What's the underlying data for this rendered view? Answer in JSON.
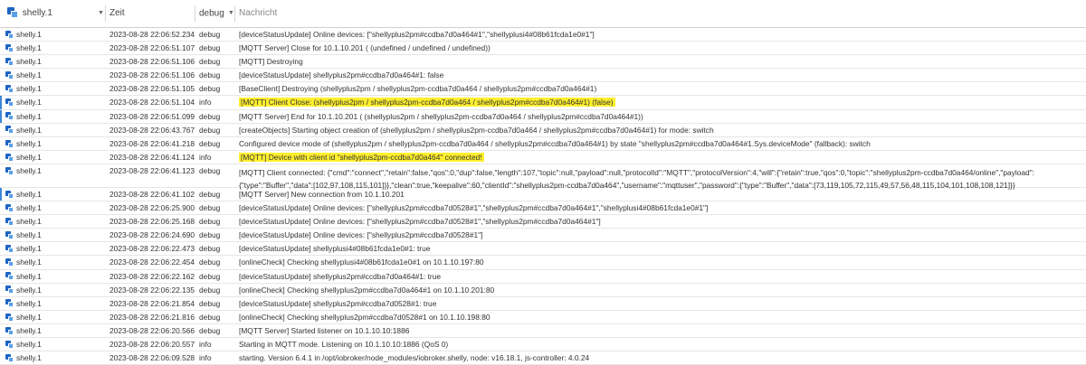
{
  "header": {
    "source_filter": "shelly.1",
    "col_time": "Zeit",
    "col_severity_filter": "debug",
    "col_message": "Nachricht"
  },
  "rows": [
    {
      "source": "shelly.1",
      "time": "2023-08-28 22:06:52.234",
      "severity": "debug",
      "message": "[deviceStatusUpdate] Online devices: [\"shellyplus2pm#ccdba7d0a464#1\",\"shellyplusi4#08b61fcda1e0#1\"]",
      "highlight": false,
      "marked": false
    },
    {
      "source": "shelly.1",
      "time": "2023-08-28 22:06:51.107",
      "severity": "debug",
      "message": "[MQTT Server] Close for 10.1.10.201 ( (undefined / undefined / undefined))",
      "highlight": false,
      "marked": false
    },
    {
      "source": "shelly.1",
      "time": "2023-08-28 22:06:51.106",
      "severity": "debug",
      "message": "[MQTT] Destroying",
      "highlight": false,
      "marked": false
    },
    {
      "source": "shelly.1",
      "time": "2023-08-28 22:06:51.106",
      "severity": "debug",
      "message": "[deviceStatusUpdate] shellyplus2pm#ccdba7d0a464#1: false",
      "highlight": false,
      "marked": false
    },
    {
      "source": "shelly.1",
      "time": "2023-08-28 22:06:51.105",
      "severity": "debug",
      "message": "[BaseClient] Destroying (shellyplus2pm / shellyplus2pm-ccdba7d0a464 / shellyplus2pm#ccdba7d0a464#1)",
      "highlight": false,
      "marked": false
    },
    {
      "source": "shelly.1",
      "time": "2023-08-28 22:06:51.104",
      "severity": "info",
      "message": "[MQTT] Client Close: (shellyplus2pm / shellyplus2pm-ccdba7d0a464 / shellyplus2pm#ccdba7d0a464#1) (false)",
      "highlight": true,
      "marked": true
    },
    {
      "source": "shelly.1",
      "time": "2023-08-28 22:06:51.099",
      "severity": "debug",
      "message": "[MQTT Server] End for 10.1.10.201 ( (shellyplus2pm / shellyplus2pm-ccdba7d0a464 / shellyplus2pm#ccdba7d0a464#1))",
      "highlight": false,
      "marked": true
    },
    {
      "source": "shelly.1",
      "time": "2023-08-28 22:06:43.767",
      "severity": "debug",
      "message": "[createObjects] Starting object creation of (shellyplus2pm / shellyplus2pm-ccdba7d0a464 / shellyplus2pm#ccdba7d0a464#1) for mode: switch",
      "highlight": false,
      "marked": false
    },
    {
      "source": "shelly.1",
      "time": "2023-08-28 22:06:41.218",
      "severity": "debug",
      "message": "Configured device mode of (shellyplus2pm / shellyplus2pm-ccdba7d0a464 / shellyplus2pm#ccdba7d0a464#1) by state \"shellyplus2pm#ccdba7d0a464#1.Sys.deviceMode\" (fallback): switch",
      "highlight": false,
      "marked": false
    },
    {
      "source": "shelly.1",
      "time": "2023-08-28 22:06:41.124",
      "severity": "info",
      "message": "[MQTT] Device with client id \"shellyplus2pm-ccdba7d0a464\" connected!",
      "highlight": true,
      "marked": false
    },
    {
      "source": "shelly.1",
      "time": "2023-08-28 22:06:41.123",
      "severity": "debug",
      "message": "[MQTT] Client connected: {\"cmd\":\"connect\",\"retain\":false,\"qos\":0,\"dup\":false,\"length\":107,\"topic\":null,\"payload\":null,\"protocolId\":\"MQTT\",\"protocolVersion\":4,\"will\":{\"retain\":true,\"qos\":0,\"topic\":\"shellyplus2pm-ccdba7d0a464/online\",\"payload\":{\"type\":\"Buffer\",\"data\":[102,97,108,115,101]}},\"clean\":true,\"keepalive\":60,\"clientId\":\"shellyplus2pm-ccdba7d0a464\",\"username\":\"mqttuser\",\"password\":{\"type\":\"Buffer\",\"data\":[73,119,105,72,115,49,57,56,48,115,104,101,108,108,121]}}",
      "highlight": false,
      "marked": false,
      "tall": true
    },
    {
      "source": "shelly.1",
      "time": "2023-08-28 22:06:41.102",
      "severity": "debug",
      "message": "[MQTT Server] New connection from 10.1.10.201",
      "highlight": false,
      "marked": true
    },
    {
      "source": "shelly.1",
      "time": "2023-08-28 22:06:25.900",
      "severity": "debug",
      "message": "[deviceStatusUpdate] Online devices: [\"shellyplus2pm#ccdba7d0528#1\",\"shellyplus2pm#ccdba7d0a464#1\",\"shellyplusi4#08b61fcda1e0#1\"]",
      "highlight": false,
      "marked": false
    },
    {
      "source": "shelly.1",
      "time": "2023-08-28 22:06:25.168",
      "severity": "debug",
      "message": "[deviceStatusUpdate] Online devices: [\"shellyplus2pm#ccdba7d0528#1\",\"shellyplus2pm#ccdba7d0a464#1\"]",
      "highlight": false,
      "marked": false
    },
    {
      "source": "shelly.1",
      "time": "2023-08-28 22:06:24.690",
      "severity": "debug",
      "message": "[deviceStatusUpdate] Online devices: [\"shellyplus2pm#ccdba7d0528#1\"]",
      "highlight": false,
      "marked": false
    },
    {
      "source": "shelly.1",
      "time": "2023-08-28 22:06:22.473",
      "severity": "debug",
      "message": "[deviceStatusUpdate] shellyplusi4#08b61fcda1e0#1: true",
      "highlight": false,
      "marked": false
    },
    {
      "source": "shelly.1",
      "time": "2023-08-28 22:06:22.454",
      "severity": "debug",
      "message": "[onlineCheck] Checking shellyplusi4#08b61fcda1e0#1 on 10.1.10.197:80",
      "highlight": false,
      "marked": false
    },
    {
      "source": "shelly.1",
      "time": "2023-08-28 22:06:22.162",
      "severity": "debug",
      "message": "[deviceStatusUpdate] shellyplus2pm#ccdba7d0a464#1: true",
      "highlight": false,
      "marked": false
    },
    {
      "source": "shelly.1",
      "time": "2023-08-28 22:06:22.135",
      "severity": "debug",
      "message": "[onlineCheck] Checking shellyplus2pm#ccdba7d0a464#1 on 10.1.10.201:80",
      "highlight": false,
      "marked": false
    },
    {
      "source": "shelly.1",
      "time": "2023-08-28 22:06:21.854",
      "severity": "debug",
      "message": "[deviceStatusUpdate] shellyplus2pm#ccdba7d0528#1: true",
      "highlight": false,
      "marked": false
    },
    {
      "source": "shelly.1",
      "time": "2023-08-28 22:06:21.816",
      "severity": "debug",
      "message": "[onlineCheck] Checking shellyplus2pm#ccdba7d0528#1 on 10.1.10.198:80",
      "highlight": false,
      "marked": false
    },
    {
      "source": "shelly.1",
      "time": "2023-08-28 22:06:20.566",
      "severity": "debug",
      "message": "[MQTT Server] Started listener on 10.1.10.10:1886",
      "highlight": false,
      "marked": false
    },
    {
      "source": "shelly.1",
      "time": "2023-08-28 22:06:20.557",
      "severity": "info",
      "message": "Starting in MQTT mode. Listening on 10.1.10.10:1886 (QoS 0)",
      "highlight": false,
      "marked": false
    },
    {
      "source": "shelly.1",
      "time": "2023-08-28 22:06:09.528",
      "severity": "info",
      "message": "starting. Version 6.4.1 in /opt/iobroker/node_modules/iobroker.shelly, node: v16.18.1, js-controller: 4.0.24",
      "highlight": false,
      "marked": false
    }
  ],
  "colors": {
    "highlight": "#ffef2e",
    "marker": "#3c86d8",
    "icon_dark": "#1f64c4",
    "icon_light": "#5aa0e8"
  }
}
